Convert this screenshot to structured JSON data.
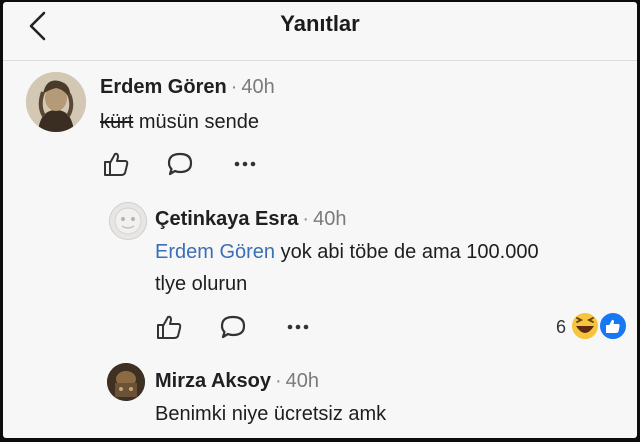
{
  "header": {
    "title": "Yanıtlar"
  },
  "comments": [
    {
      "author": "Erdem Gören",
      "time": "40h",
      "text_struck": "kürt",
      "text_rest": " müsün sende"
    },
    {
      "author": "Çetinkaya Esra",
      "time": "40h",
      "mention": "Erdem Gören",
      "text_line1": " yok abi töbe de ama 100.000",
      "text_line2": "tlye olurun",
      "reaction_count": "6",
      "reactions": [
        "haha-icon",
        "like-icon"
      ]
    },
    {
      "author": "Mirza Aksoy",
      "time": "40h",
      "text": "Benimki niye ücretsiz amk"
    }
  ],
  "colors": {
    "background": "#f7f7f7",
    "mention": "#3b6fb5",
    "like_reaction": "#1877f2",
    "haha_reaction": "#f7c43b"
  }
}
